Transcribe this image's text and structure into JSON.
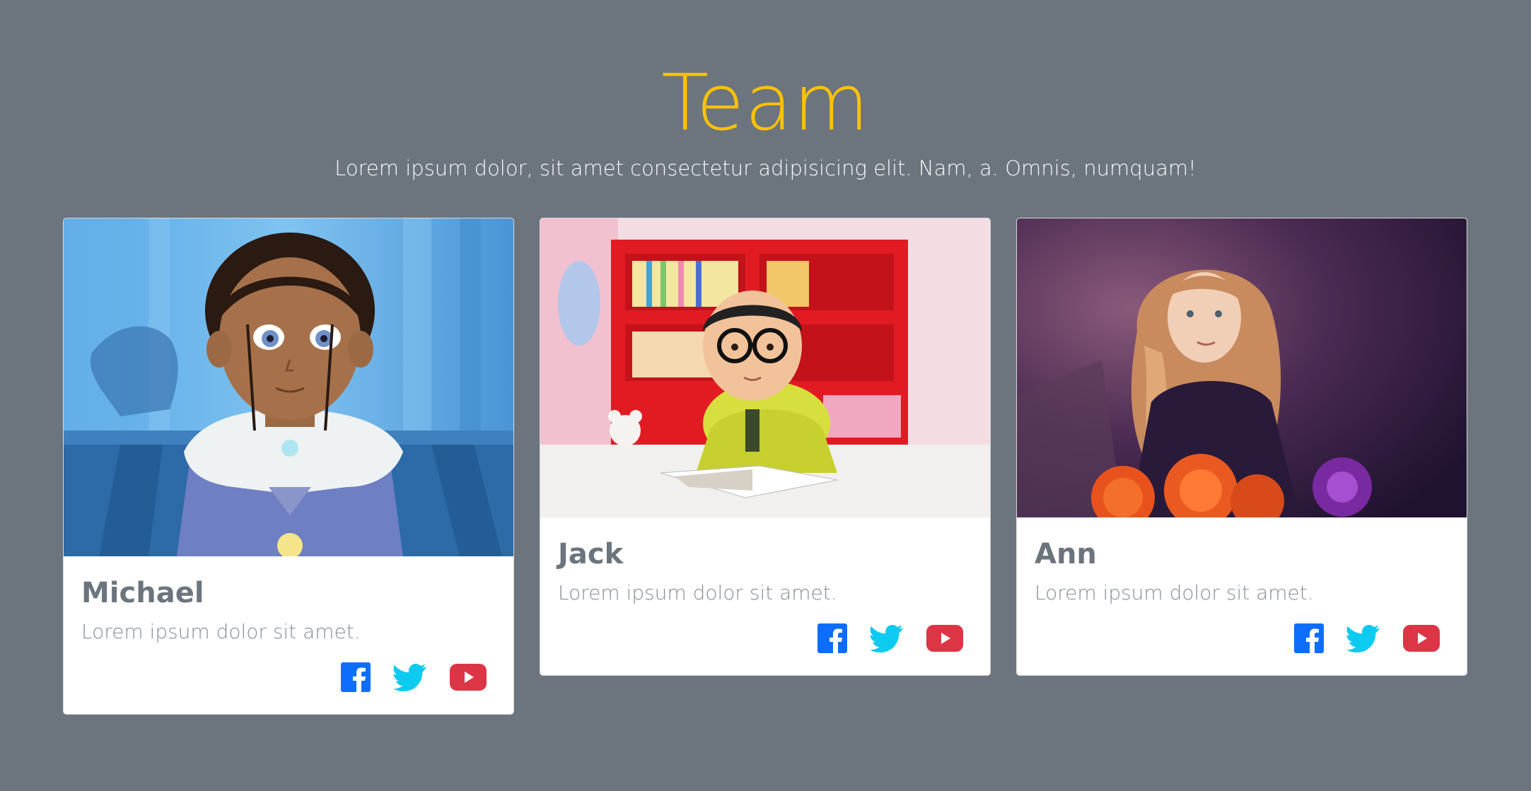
{
  "header": {
    "title": "Team",
    "subtitle": "Lorem ipsum dolor, sit amet consectetur adipisicing elit. Nam, a. Omnis, numquam!"
  },
  "colors": {
    "background": "#6c757d",
    "accent": "#ffc107",
    "facebook": "#0d6efd",
    "twitter": "#0dcaf0",
    "youtube": "#dc3545"
  },
  "members": [
    {
      "name": "Michael",
      "description": "Lorem ipsum dolor sit amet.",
      "photo": "cartoon-girl-portrait"
    },
    {
      "name": "Jack",
      "description": "Lorem ipsum dolor sit amet.",
      "photo": "boy-with-glasses-reading"
    },
    {
      "name": "Ann",
      "description": "Lorem ipsum dolor sit amet.",
      "photo": "girl-with-flowers"
    }
  ],
  "social_icons": [
    "facebook-icon",
    "twitter-icon",
    "youtube-icon"
  ]
}
